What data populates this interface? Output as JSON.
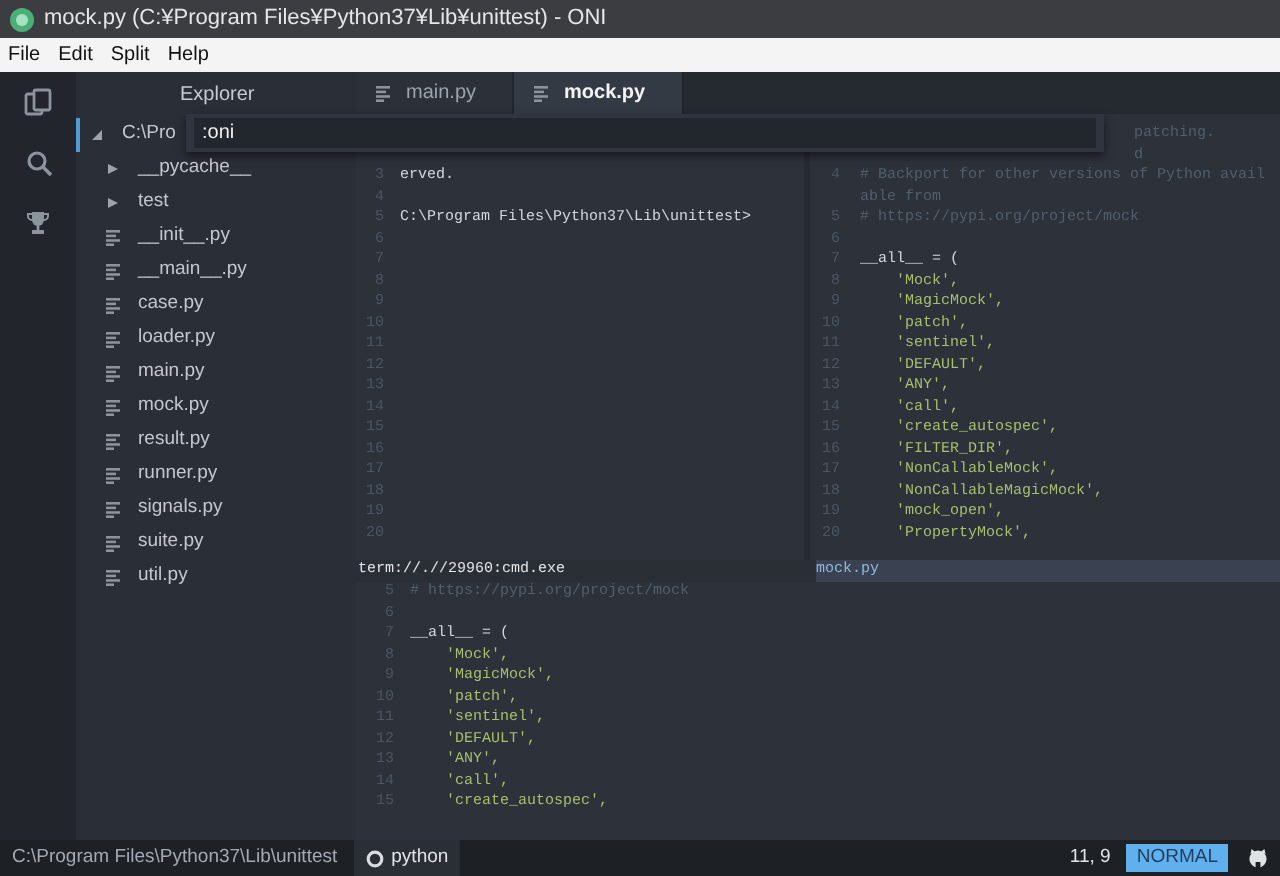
{
  "window": {
    "title": "mock.py (C:¥Program Files¥Python37¥Lib¥unittest) - ONI"
  },
  "menu": [
    "File",
    "Edit",
    "Split",
    "Help"
  ],
  "explorer": {
    "title": "Explorer",
    "tree": [
      {
        "label": "C:\\Pro",
        "kind": "folder",
        "expanded": true,
        "selected": true,
        "children": [
          {
            "label": "__pycache__",
            "kind": "folder",
            "expanded": false,
            "selected": false
          },
          {
            "label": "test",
            "kind": "folder",
            "expanded": false,
            "selected": false
          },
          {
            "label": "__init__.py",
            "kind": "file",
            "selected": false
          },
          {
            "label": "__main__.py",
            "kind": "file",
            "selected": false
          },
          {
            "label": "case.py",
            "kind": "file",
            "selected": false
          },
          {
            "label": "loader.py",
            "kind": "file",
            "selected": false
          },
          {
            "label": "main.py",
            "kind": "file",
            "selected": false
          },
          {
            "label": "mock.py",
            "kind": "file",
            "selected": false
          },
          {
            "label": "result.py",
            "kind": "file",
            "selected": false
          },
          {
            "label": "runner.py",
            "kind": "file",
            "selected": false
          },
          {
            "label": "signals.py",
            "kind": "file",
            "selected": false
          },
          {
            "label": "suite.py",
            "kind": "file",
            "selected": false
          },
          {
            "label": "util.py",
            "kind": "file",
            "selected": false
          }
        ]
      }
    ]
  },
  "command_line": {
    "value": ":oni"
  },
  "tabs": [
    {
      "label": "main.py",
      "selected": false
    },
    {
      "label": "mock.py",
      "selected": true
    }
  ],
  "panes": [
    {
      "name": "term://.//29960:cmd.exe",
      "active": false,
      "lines": [
        {
          "num": "3",
          "text": "erved.",
          "kind": "code"
        },
        {
          "num": "4"
        },
        {
          "num": "5",
          "text": "C:\\Program Files\\Python37\\Lib\\unittest>",
          "kind": "code"
        },
        {
          "num": "6"
        },
        {
          "num": "7"
        },
        {
          "num": "8"
        },
        {
          "num": "9"
        },
        {
          "num": "10"
        },
        {
          "num": "11"
        },
        {
          "num": "12"
        },
        {
          "num": "13"
        },
        {
          "num": "14"
        },
        {
          "num": "15"
        },
        {
          "num": "16"
        },
        {
          "num": "17"
        },
        {
          "num": "18"
        },
        {
          "num": "19"
        },
        {
          "num": "20"
        }
      ]
    },
    {
      "name": "mock.py",
      "active": true,
      "lines": [
        {
          "text": "patching.",
          "kind": "partial"
        },
        {
          "text": "d",
          "kind": "partial"
        },
        {
          "num": "4",
          "text": "# Backport for other versions of Python avail",
          "kind": "comment"
        },
        {
          "text": "able from",
          "kind": "comment"
        },
        {
          "num": "5",
          "text": "# https://pypi.org/project/mock",
          "kind": "comment"
        },
        {
          "num": "6"
        },
        {
          "num": "7",
          "text": "__all__ = (",
          "kind": "code"
        },
        {
          "num": "8",
          "text": "    'Mock',",
          "kind": "string"
        },
        {
          "num": "9",
          "text": "    'MagicMock',",
          "kind": "string"
        },
        {
          "num": "10",
          "text": "    'patch',",
          "kind": "string"
        },
        {
          "num": "11",
          "text": "    'sentinel',",
          "kind": "string"
        },
        {
          "num": "12",
          "text": "    'DEFAULT',",
          "kind": "string"
        },
        {
          "num": "13",
          "text": "    'ANY',",
          "kind": "string"
        },
        {
          "num": "14",
          "text": "    'call',",
          "kind": "string"
        },
        {
          "num": "15",
          "text": "    'create_autospec',",
          "kind": "string"
        },
        {
          "num": "16",
          "text": "    'FILTER_DIR',",
          "kind": "string"
        },
        {
          "num": "17",
          "text": "    'NonCallableMock',",
          "kind": "string"
        },
        {
          "num": "18",
          "text": "    'NonCallableMagicMock',",
          "kind": "string"
        },
        {
          "num": "19",
          "text": "    'mock_open',",
          "kind": "string"
        },
        {
          "num": "20",
          "text": "    'PropertyMock',",
          "kind": "string"
        }
      ]
    }
  ],
  "bottom_pane": {
    "lines": [
      {
        "num": "5",
        "text": "# https://pypi.org/project/mock",
        "kind": "comment"
      },
      {
        "num": "6"
      },
      {
        "num": "7",
        "text": "__all__ = (",
        "kind": "code"
      },
      {
        "num": "8",
        "text": "    'Mock',",
        "kind": "string"
      },
      {
        "num": "9",
        "text": "    'MagicMock',",
        "kind": "string"
      },
      {
        "num": "10",
        "text": "    'patch',",
        "kind": "string"
      },
      {
        "num": "11",
        "text": "    'sentinel',",
        "kind": "string"
      },
      {
        "num": "12",
        "text": "    'DEFAULT',",
        "kind": "string"
      },
      {
        "num": "13",
        "text": "    'ANY',",
        "kind": "string"
      },
      {
        "num": "14",
        "text": "    'call',",
        "kind": "string"
      },
      {
        "num": "15",
        "text": "    'create_autospec',",
        "kind": "string"
      }
    ]
  },
  "status_bar": {
    "path": "C:\\Program Files\\Python37\\Lib\\unittest",
    "language": "python",
    "position": "11, 9",
    "mode": "NORMAL"
  }
}
